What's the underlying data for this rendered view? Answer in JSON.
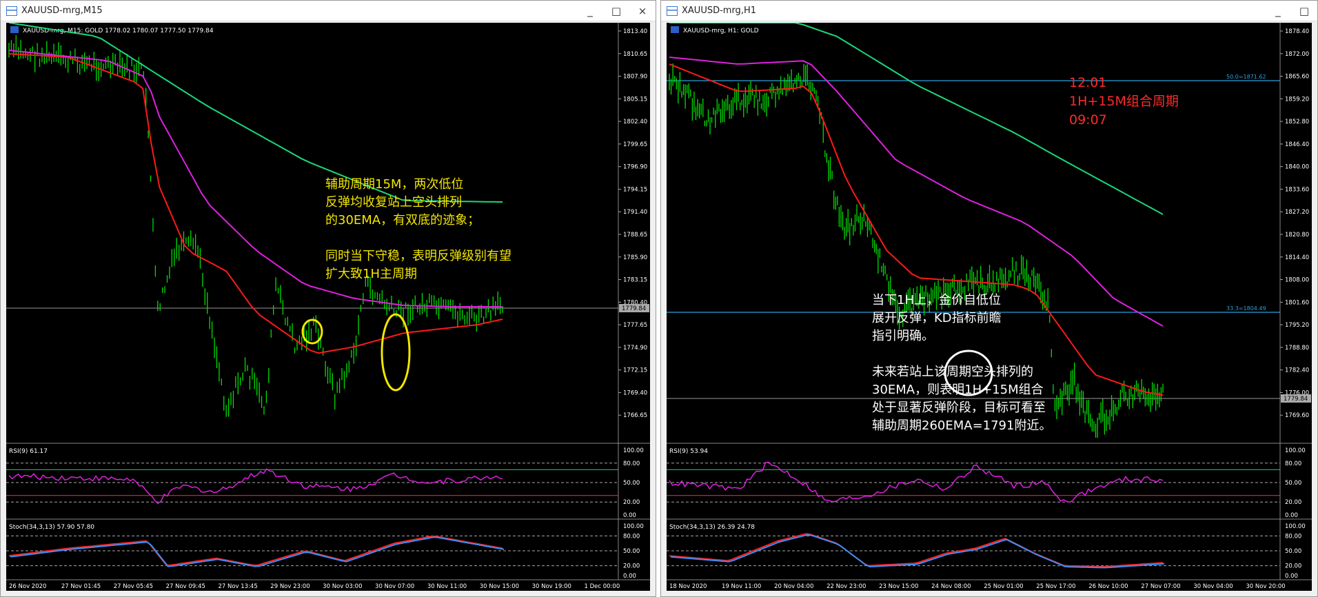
{
  "left": {
    "title": "XAUUSD-mrg,M15",
    "info": "XAUUSD-mrg, M15:  GOLD  1778.02 1780.07 1777.50 1779.84",
    "price_labels": [
      "1813.40",
      "1810.65",
      "1807.90",
      "1805.15",
      "1802.40",
      "1799.65",
      "1796.90",
      "1794.15",
      "1791.40",
      "1788.65",
      "1785.90",
      "1783.15",
      "1780.40",
      "1777.65",
      "1774.90",
      "1772.15",
      "1769.40",
      "1766.65"
    ],
    "current_price": "1779.84",
    "annotation": "辅助周期15M，两次低位\n反弹均收复站上空头排列\n的30EMA，有双底的迹象；\n\n同时当下守稳，表明反弹级别有望\n扩大致1H主周期",
    "rsi_label": "RSI(9) 61.17",
    "stoch_label": "Stoch(34,3,13) 57.90 57.80",
    "rsi_levels": [
      "100.00",
      "80.00",
      "50.00",
      "20.00",
      "0.00"
    ],
    "stoch_levels": [
      "100.00",
      "80.00",
      "50.00",
      "20.00",
      "0.00"
    ],
    "time_labels": [
      "26 Nov 2020",
      "27 Nov 01:45",
      "27 Nov 05:45",
      "27 Nov 09:45",
      "27 Nov 13:45",
      "29 Nov 23:00",
      "30 Nov 03:00",
      "30 Nov 07:00",
      "30 Nov 11:00",
      "30 Nov 15:00",
      "30 Nov 19:00",
      "1 Dec 00:00"
    ]
  },
  "right": {
    "title": "XAUUSD-mrg,H1",
    "info": "XAUUSD-mrg, H1:  GOLD",
    "price_labels": [
      "1878.40",
      "1872.00",
      "1865.60",
      "1859.20",
      "1852.80",
      "1846.40",
      "1840.00",
      "1833.60",
      "1827.20",
      "1820.80",
      "1814.40",
      "1808.00",
      "1801.60",
      "1795.20",
      "1788.80",
      "1782.40",
      "1776.00",
      "1769.60"
    ],
    "current_price": "1779.84",
    "fib_top": "50.0=1871.62",
    "fib_mid": "33.3=1804.49",
    "red_note": "12.01\n1H+15M组合周期\n09:07",
    "annotation": "当下1H上，金价自低位\n展开反弹，KD指标前瞻\n指引明确。\n\n未来若站上该周期空头排列的\n30EMA，则表明1H+15M组合\n处于显著反弹阶段，目标可看至\n辅助周期260EMA=1791附近。",
    "rsi_label": "RSI(9) 53.94",
    "stoch_label": "Stoch(34,3,13) 26.39 24.78",
    "rsi_levels": [
      "100.00",
      "80.00",
      "50.00",
      "20.00",
      "0.00"
    ],
    "stoch_levels": [
      "100.00",
      "80.00",
      "50.00",
      "20.00",
      "0.00"
    ],
    "time_labels": [
      "18 Nov 2020",
      "19 Nov 11:00",
      "20 Nov 04:00",
      "22 Nov 23:00",
      "23 Nov 15:00",
      "24 Nov 08:00",
      "25 Nov 01:00",
      "25 Nov 17:00",
      "26 Nov 10:00",
      "27 Nov 07:00",
      "30 Nov 04:00",
      "30 Nov 20:00"
    ]
  },
  "window_controls": [
    "_",
    "□",
    "×"
  ],
  "colors": {
    "candle": "#00e000",
    "ema30": "#ff1a1a",
    "ema_mid": "#e020e0",
    "ema_long": "#1ad97a",
    "rsi": "#e020e0",
    "stoch_main": "#ff2020",
    "stoch_signal": "#3a8ff5",
    "fib": "#29a3e0",
    "annotation_yellow": "#f2e600",
    "red_note": "#ff2a2a",
    "circle_yellow": "#f2e600"
  }
}
